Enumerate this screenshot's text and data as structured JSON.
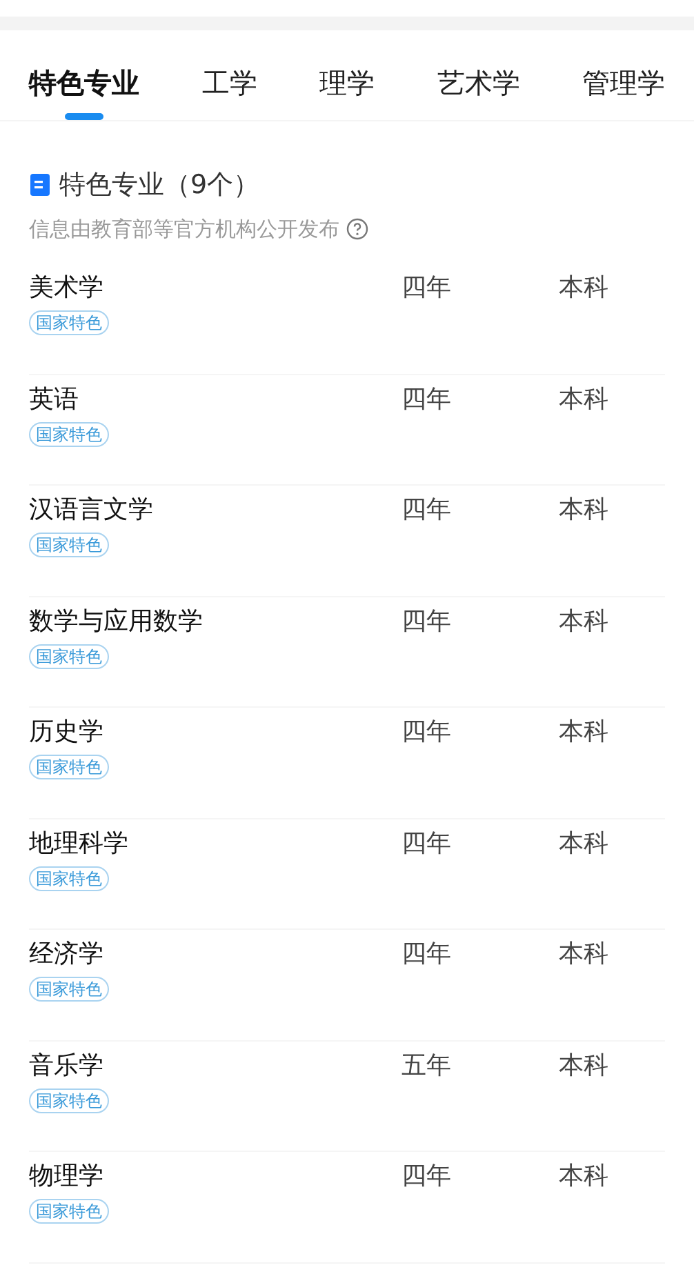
{
  "tabs": [
    {
      "label": "特色专业",
      "selected": true
    },
    {
      "label": "工学",
      "selected": false
    },
    {
      "label": "理学",
      "selected": false
    },
    {
      "label": "艺术学",
      "selected": false
    },
    {
      "label": "管理学",
      "selected": false
    }
  ],
  "section": {
    "title": "特色专业（9个）",
    "note": "信息由教育部等官方机构公开发布"
  },
  "majors": [
    {
      "name": "美术学",
      "duration": "四年",
      "level": "本科",
      "tag": "国家特色"
    },
    {
      "name": "英语",
      "duration": "四年",
      "level": "本科",
      "tag": "国家特色"
    },
    {
      "name": "汉语言文学",
      "duration": "四年",
      "level": "本科",
      "tag": "国家特色"
    },
    {
      "name": "数学与应用数学",
      "duration": "四年",
      "level": "本科",
      "tag": "国家特色"
    },
    {
      "name": "历史学",
      "duration": "四年",
      "level": "本科",
      "tag": "国家特色"
    },
    {
      "name": "地理科学",
      "duration": "四年",
      "level": "本科",
      "tag": "国家特色"
    },
    {
      "name": "经济学",
      "duration": "四年",
      "level": "本科",
      "tag": "国家特色"
    },
    {
      "name": "音乐学",
      "duration": "五年",
      "level": "本科",
      "tag": "国家特色"
    },
    {
      "name": "物理学",
      "duration": "四年",
      "level": "本科",
      "tag": "国家特色"
    }
  ]
}
